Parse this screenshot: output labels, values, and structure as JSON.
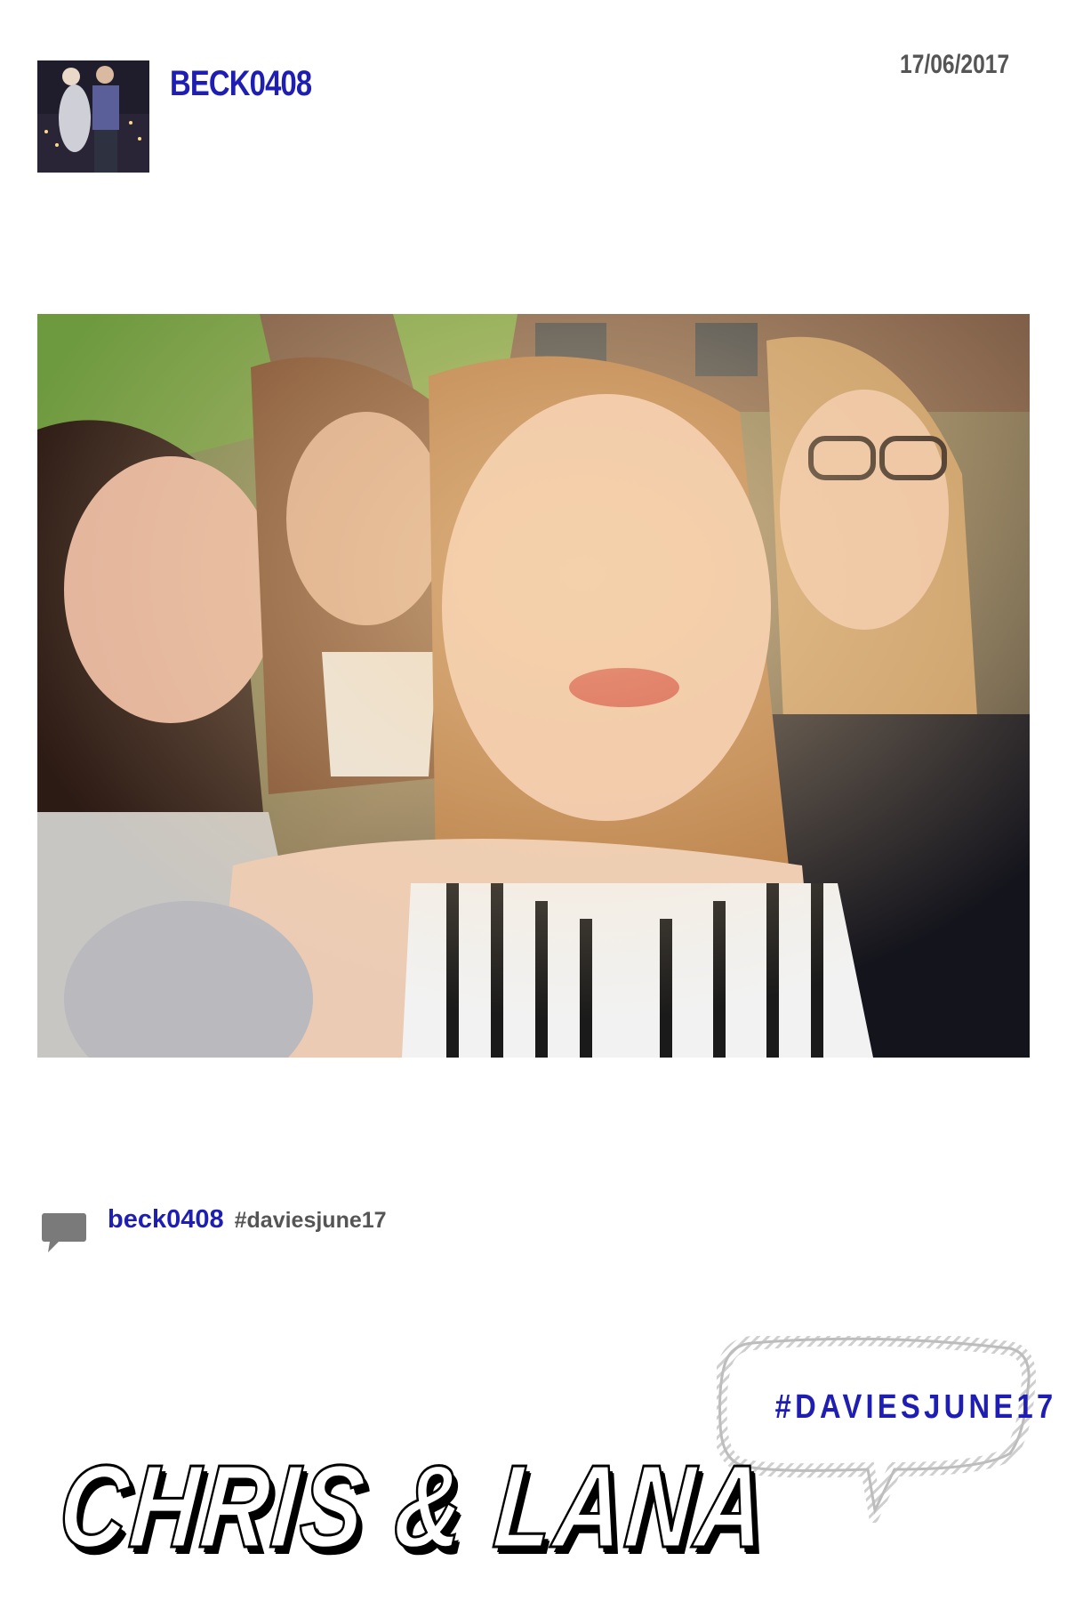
{
  "post": {
    "author": "BECK0408",
    "date": "17/06/2017"
  },
  "caption": {
    "user": "beck0408",
    "text": "#daviesjune17"
  },
  "branding": {
    "hashtag": "#DAVIESJUNE17",
    "couple": "CHRIS & LANA"
  },
  "icons": {
    "comment": "comment-bubble-icon"
  },
  "colors": {
    "accent_blue": "#1e1eb4",
    "date_gray": "#555555",
    "bubble_stroke": "#c8c8c8",
    "background": "#ffffff"
  }
}
